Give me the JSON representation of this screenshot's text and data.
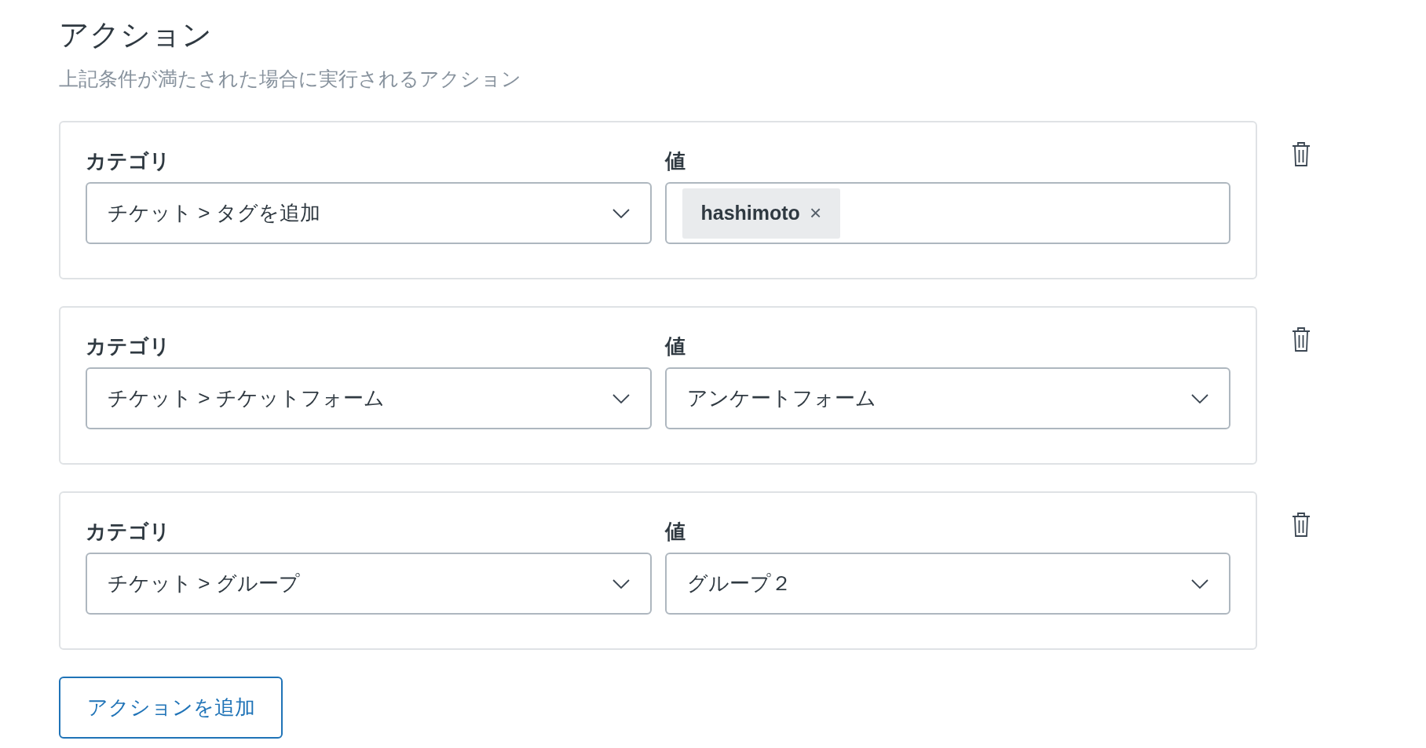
{
  "title": "アクション",
  "subtitle": "上記条件が満たされた場合に実行されるアクション",
  "actions": [
    {
      "category_label": "カテゴリ",
      "category": "チケット > タグを追加",
      "value_label": "値",
      "value": {
        "kind": "tags",
        "tags": [
          {
            "label": "hashimoto",
            "remove": "×"
          }
        ]
      }
    },
    {
      "category_label": "カテゴリ",
      "category": "チケット > チケットフォーム",
      "value_label": "値",
      "value": {
        "kind": "select",
        "text": "アンケートフォーム"
      }
    },
    {
      "category_label": "カテゴリ",
      "category": "チケット > グループ",
      "value_label": "値",
      "value": {
        "kind": "select",
        "text": "グループ２"
      }
    }
  ],
  "add_button": "アクションを追加"
}
